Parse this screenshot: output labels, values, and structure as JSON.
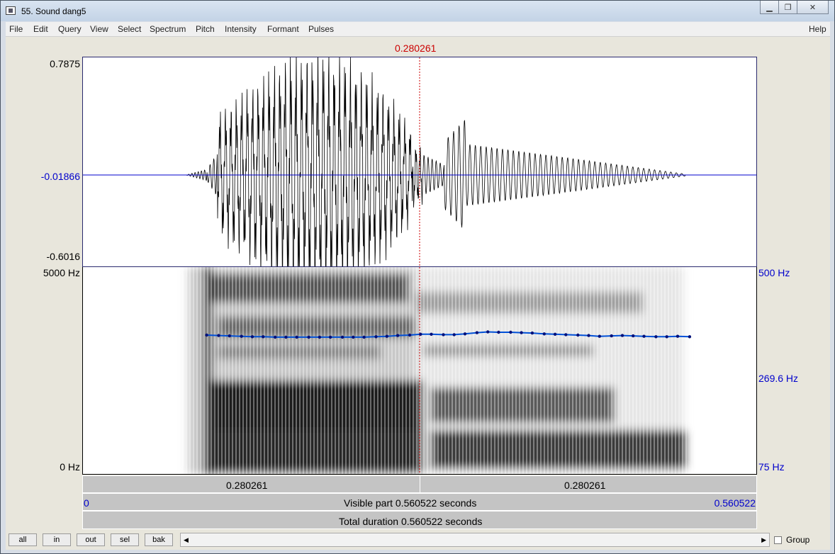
{
  "window": {
    "title": "55. Sound dang5"
  },
  "menubar": {
    "items": [
      "File",
      "Edit",
      "Query",
      "View",
      "Select",
      "Spectrum",
      "Pitch",
      "Intensity",
      "Formant",
      "Pulses"
    ],
    "help": "Help"
  },
  "cursor": {
    "time_label": "0.280261"
  },
  "waveform": {
    "ymax": "0.7875",
    "ymid": "-0.01866",
    "ymin": "-0.6016"
  },
  "spectrogram": {
    "fmax": "5000 Hz",
    "fmin": "0 Hz",
    "pitch_max": "500 Hz",
    "pitch_cursor": "269.6 Hz",
    "pitch_min": "75 Hz"
  },
  "pitch_track": {
    "unit": "Hz",
    "range": [
      75,
      500
    ],
    "times": [
      0.103,
      0.113,
      0.122,
      0.132,
      0.141,
      0.15,
      0.16,
      0.169,
      0.178,
      0.188,
      0.197,
      0.206,
      0.216,
      0.225,
      0.234,
      0.244,
      0.253,
      0.262,
      0.272,
      0.281,
      0.29,
      0.3,
      0.309,
      0.318,
      0.328,
      0.337,
      0.346,
      0.356,
      0.365,
      0.374,
      0.384,
      0.393,
      0.402,
      0.412,
      0.421,
      0.43,
      0.44,
      0.449,
      0.458,
      0.467,
      0.477,
      0.486,
      0.495,
      0.505
    ],
    "values": [
      268,
      267,
      266,
      265,
      264,
      264,
      263,
      263,
      263,
      263,
      263,
      263,
      263,
      263,
      263,
      264,
      265,
      267,
      268,
      270,
      270,
      269,
      269,
      271,
      274,
      276,
      275,
      275,
      274,
      273,
      271,
      270,
      269,
      268,
      267,
      265,
      266,
      267,
      266,
      265,
      264,
      264,
      265,
      264
    ]
  },
  "time_axis": {
    "left_segment": "0.280261",
    "right_segment": "0.280261",
    "visible_start": "0",
    "visible_label": "Visible part 0.560522 seconds",
    "visible_end": "0.560522",
    "total_label": "Total duration 0.560522 seconds",
    "visible_duration": 0.560522,
    "cursor_time": 0.280261
  },
  "buttons": {
    "all": "all",
    "in": "in",
    "out": "out",
    "sel": "sel",
    "bak": "bak"
  },
  "group_label": "Group",
  "colors": {
    "cursor": "#cc0000",
    "axis_blue": "#0000cc",
    "pitch": "#0050d8"
  }
}
